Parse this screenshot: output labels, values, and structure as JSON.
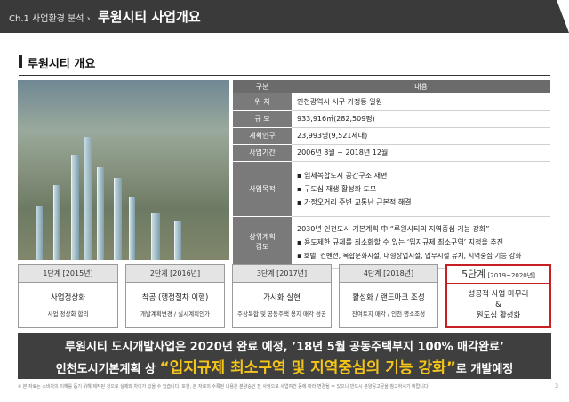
{
  "header": {
    "chapter": "Ch.1 사업환경 분석 › ",
    "title": "루원시티 사업개요"
  },
  "section": {
    "title": "루원시티 개요"
  },
  "info_table": {
    "col_key": "구분",
    "col_val": "내용",
    "rows": [
      {
        "key": "위  치",
        "value": "인천광역시 서구 가정동 일원"
      },
      {
        "key": "규  모",
        "value": "933,916㎡(282,509평)"
      },
      {
        "key": "계획인구",
        "value": "23,993명(9,521세대)"
      },
      {
        "key": "사업기간",
        "value": "2006년 8월 ~ 2018년 12월"
      }
    ],
    "purpose": {
      "key": "사업목적",
      "items": [
        "▪ 입체복합도시 공간구조 재편",
        "▪ 구도심 재생 활성화 도모",
        "▪ 가정오거리 주변 교통난 근본적 해결"
      ]
    },
    "plan": {
      "key1": "상위계획",
      "key2": "검토",
      "items": [
        "2030년 인천도시 기본계획 中 “루원시티의 지역중심 기능 강화”",
        "▪ 용도제한 규제를 최소화할 수 있는 ‘입지규제 최소구역’ 지정을 추진",
        "▪ 호텔, 컨벤션, 복합문화시설, 대형상업시설, 업무시설 유치, 지역중심 기능 강화"
      ]
    }
  },
  "stages": [
    {
      "head": "1단계 [2015년]",
      "main": "사업정상화",
      "sub": "사업 정상화 합의"
    },
    {
      "head": "2단계 [2016년]",
      "main": "착공 (행정절차 이행)",
      "sub": "개발계획변경 / 실시계획인가"
    },
    {
      "head": "3단계 [2017년]",
      "main": "가시화 실현",
      "sub": "주상복합 및 공동주택 용지 매각 성공"
    },
    {
      "head": "4단계 [2018년]",
      "main": "활성화 / 랜드마크 조성",
      "sub": "잔여토지 매각 / 인천 명소조성"
    }
  ],
  "stage5": {
    "head": "5단계",
    "years": " [2019~2020년]",
    "line1": "성공적 사업 마무리",
    "line2": "&",
    "line3": "원도심 활성화"
  },
  "banner": {
    "line1": "루원시티 도시개발사업은 2020년 완료 예정, ’18년 5월 공동주택부지 100% 매각완료’",
    "line2_pre": "인천도시기본계획 상 ",
    "line2_hl": "“입지규제 최소구역 및 지역중심의 기능 강화”",
    "line2_post": "로 개발예정"
  },
  "footnote": "※ 본 자료는 소비자의 이해를 돕기 위해 제작된 것으로 실제와 차이가 있을 수 있습니다. 또한, 본 자료의 수록된 내용은 분양승인 전 사항으로 사업여건 등에 따라 변경될 수 있으니 반드시 분양공고문을 참고하시기 바랍니다.",
  "page_number": "3",
  "colors": {
    "header": "#3a3a3a",
    "accent_red": "#c62024",
    "highlight_yellow": "#f5c518"
  }
}
